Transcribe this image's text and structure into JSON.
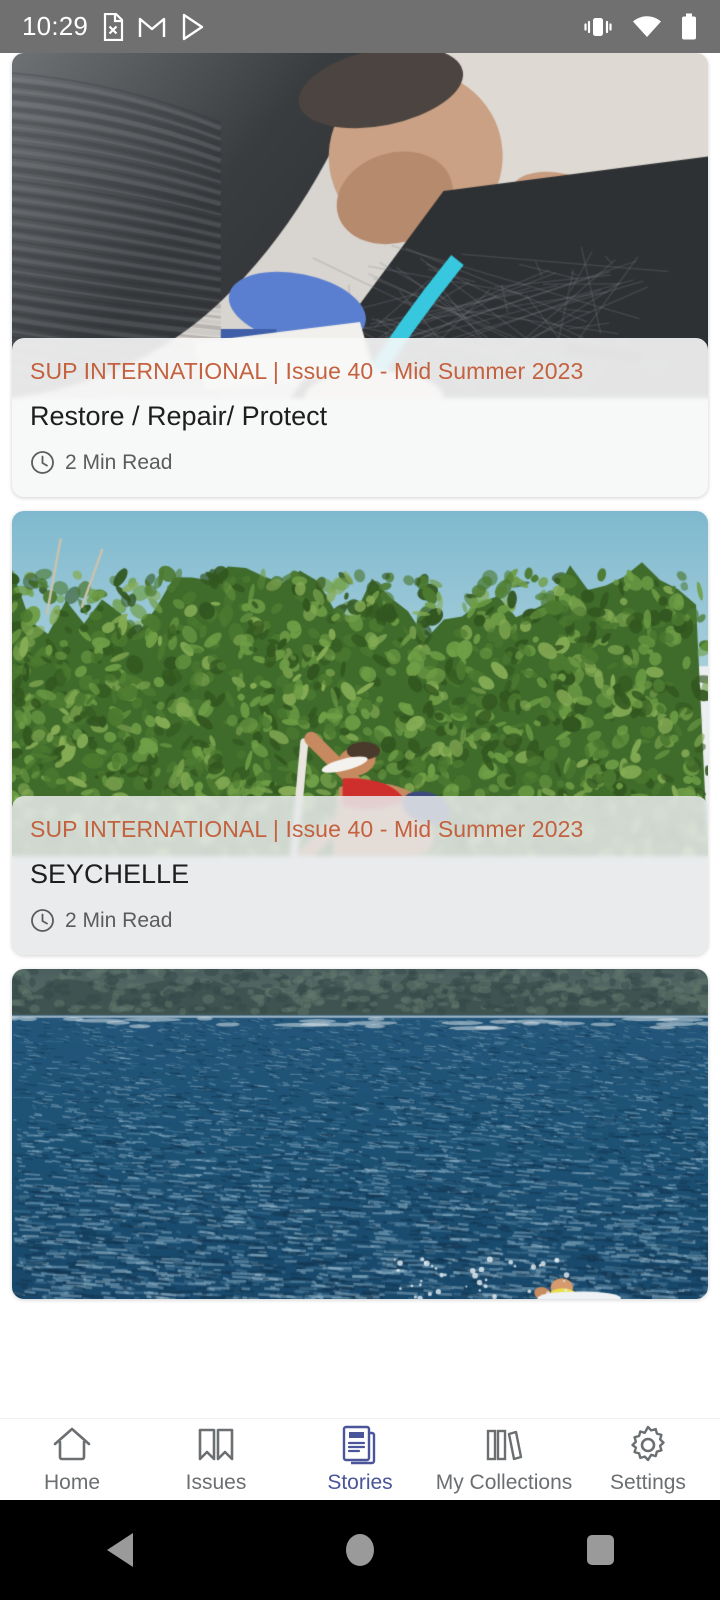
{
  "status_bar": {
    "time": "10:29",
    "left_icons": [
      "file-x-icon",
      "gmail-icon",
      "play-store-icon"
    ],
    "right_icons": [
      "vibrate-icon",
      "wifi-icon",
      "battery-icon"
    ],
    "background_color": "#707070"
  },
  "theme": {
    "accent_orange": "#c4613f",
    "active_nav_blue": "#4a559b",
    "inactive_nav_grey": "#6b6f72",
    "page_background": "#ffffff"
  },
  "stories": [
    {
      "kicker": "SUP INTERNATIONAL | Issue 40 - Mid Summer 2023",
      "title": "Restore / Repair/ Protect",
      "read_time": "2 Min Read",
      "clock_icon": "clock-icon",
      "image_alt": "man-repairing-paddleboard"
    },
    {
      "kicker": "SUP INTERNATIONAL | Issue 40 - Mid Summer 2023",
      "title": "SEYCHELLE",
      "read_time": "2 Min Read",
      "clock_icon": "clock-icon",
      "image_alt": "woman-paddleboarding-by-trees"
    },
    {
      "kicker": "",
      "title": "",
      "read_time": "",
      "clock_icon": "clock-icon",
      "image_alt": "open-ocean-with-paddler"
    }
  ],
  "bottom_nav": {
    "active_index": 2,
    "items": [
      {
        "label": "Home",
        "icon": "home-icon"
      },
      {
        "label": "Issues",
        "icon": "bookmark-icon"
      },
      {
        "label": "Stories",
        "icon": "document-lines-icon"
      },
      {
        "label": "My Collections",
        "icon": "books-shelf-icon"
      },
      {
        "label": "Settings",
        "icon": "gear-icon"
      }
    ]
  },
  "system_nav": {
    "buttons": [
      {
        "name": "back-button",
        "icon": "triangle-left-icon"
      },
      {
        "name": "home-button",
        "icon": "circle-icon"
      },
      {
        "name": "recents-button",
        "icon": "square-icon"
      }
    ]
  }
}
